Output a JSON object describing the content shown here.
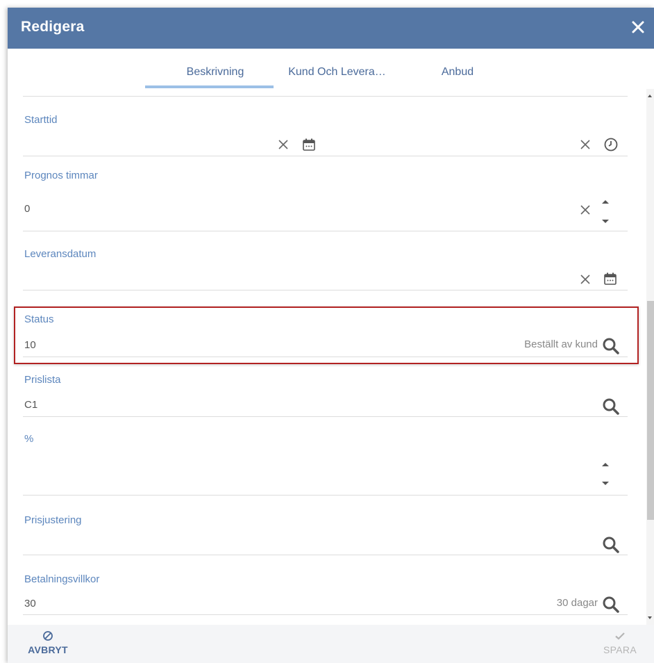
{
  "header": {
    "title": "Redigera",
    "close_icon": "close-icon"
  },
  "tabs": [
    {
      "label": "Beskrivning",
      "active": true
    },
    {
      "label": "Kund Och Levera…",
      "active": false
    },
    {
      "label": "Anbud",
      "active": false
    }
  ],
  "fields": {
    "starttid": {
      "label": "Starttid",
      "date_value": "",
      "time_value": ""
    },
    "prognos_timmar": {
      "label": "Prognos timmar",
      "value": "0"
    },
    "leveransdatum": {
      "label": "Leveransdatum",
      "value": ""
    },
    "status": {
      "label": "Status",
      "value": "10",
      "description": "Beställt av kund"
    },
    "prislista": {
      "label": "Prislista",
      "value": "C1",
      "description": ""
    },
    "procent": {
      "label": "%",
      "value": ""
    },
    "prisjustering": {
      "label": "Prisjustering",
      "value": "",
      "description": ""
    },
    "betalningsvillkor": {
      "label": "Betalningsvillkor",
      "value": "30",
      "description": "30 dagar"
    }
  },
  "footer": {
    "cancel": {
      "label": "AVBRYT",
      "icon": "cancel-circle-icon"
    },
    "save": {
      "label": "SPARA",
      "icon": "checkmark-icon"
    }
  },
  "colors": {
    "header_bg": "#5577a5",
    "label_blue": "#5c86bd",
    "tab_underline": "#9cc0e6",
    "highlight_border": "#b22222",
    "footer_cancel": "#4a6a9a",
    "footer_save_disabled": "#b5b5b5"
  }
}
